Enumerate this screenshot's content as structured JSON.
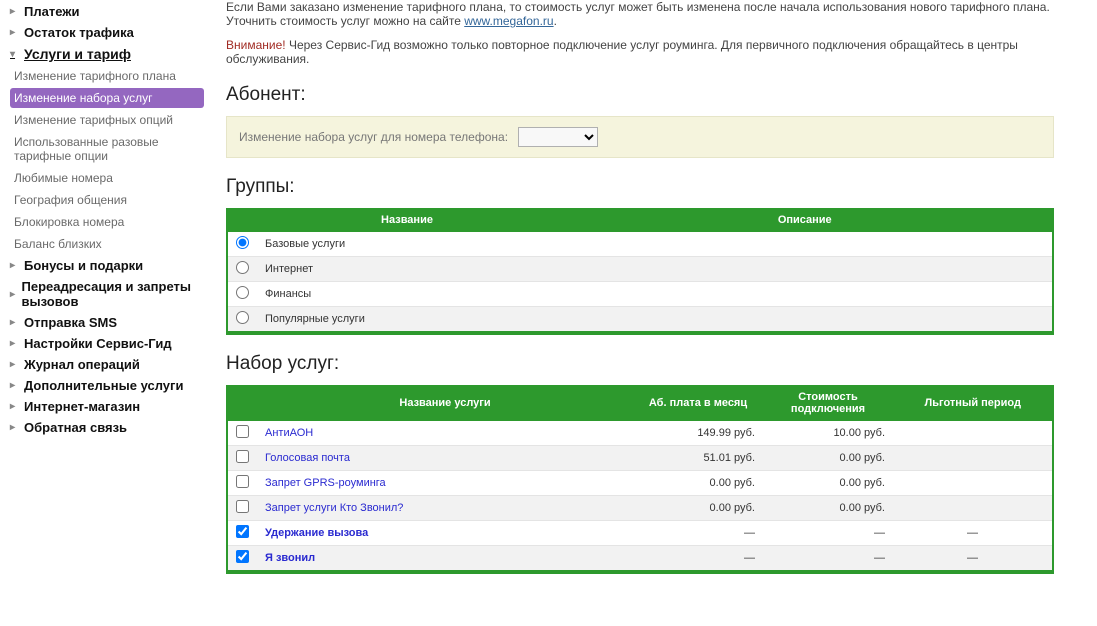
{
  "sidebar": {
    "items": [
      {
        "label": "Платежи",
        "bold": true,
        "expand": false,
        "arrow": "tri"
      },
      {
        "label": "Остаток трафика",
        "bold": true,
        "expand": false,
        "arrow": "tri"
      },
      {
        "label": "Услуги и тариф",
        "bold": true,
        "expand": true,
        "active": true,
        "arrow": "down",
        "children": [
          {
            "label": "Изменение тарифного плана"
          },
          {
            "label": "Изменение набора услуг",
            "selected": true
          },
          {
            "label": "Изменение тарифных опций"
          },
          {
            "label": "Использованные разовые тарифные опции"
          },
          {
            "label": "Любимые номера"
          },
          {
            "label": "География общения"
          },
          {
            "label": "Блокировка номера"
          },
          {
            "label": "Баланс близких"
          }
        ]
      },
      {
        "label": "Бонусы и подарки",
        "bold": true,
        "arrow": "tri"
      },
      {
        "label": "Переадресация и запреты вызовов",
        "bold": true,
        "arrow": "tri"
      },
      {
        "label": "Отправка SMS",
        "bold": true,
        "arrow": "tri"
      },
      {
        "label": "Настройки Сервис-Гид",
        "bold": true,
        "arrow": "tri"
      },
      {
        "label": "Журнал операций",
        "bold": true,
        "arrow": "tri"
      },
      {
        "label": "Дополнительные услуги",
        "bold": true,
        "arrow": "tri"
      },
      {
        "label": "Интернет-магазин",
        "bold": true,
        "arrow": "tri"
      },
      {
        "label": "Обратная связь",
        "bold": true,
        "arrow": "tri"
      }
    ]
  },
  "intro": {
    "line1": "Если Вами заказано изменение тарифного плана, то стоимость услуг может быть изменена после начала использования нового тарифного плана.",
    "line2_pre": "Уточнить стоимость услуг можно на сайте ",
    "line2_link": "www.megafon.ru",
    "line2_post": ".",
    "warn_label": "Внимание!",
    "warn_text": " Через Сервис-Гид возможно только повторное подключение услуг роуминга. Для первичного подключения обращайтесь в центры обслуживания."
  },
  "section_subscriber": "Абонент:",
  "phonebar": {
    "label": "Изменение набора услуг для номера телефона:",
    "value": ""
  },
  "section_groups": "Группы:",
  "groups": {
    "headers": [
      "Название",
      "Описание"
    ],
    "rows": [
      {
        "name": "Базовые услуги",
        "desc": "",
        "selected": true
      },
      {
        "name": "Интернет",
        "desc": ""
      },
      {
        "name": "Финансы",
        "desc": ""
      },
      {
        "name": "Популярные услуги",
        "desc": ""
      }
    ]
  },
  "section_services": "Набор услуг:",
  "services": {
    "headers": [
      "Название услуги",
      "Аб. плата в месяц",
      "Стоимость подключения",
      "Льготный период"
    ],
    "rows": [
      {
        "name": "АнтиАОН",
        "fee": "149.99 руб.",
        "conn": "10.00 руб.",
        "grace": "",
        "checked": false
      },
      {
        "name": "Голосовая почта",
        "fee": "51.01 руб.",
        "conn": "0.00 руб.",
        "grace": "",
        "checked": false
      },
      {
        "name": "Запрет GPRS-роуминга",
        "fee": "0.00 руб.",
        "conn": "0.00 руб.",
        "grace": "",
        "checked": false
      },
      {
        "name": "Запрет услуги Кто Звонил?",
        "fee": "0.00 руб.",
        "conn": "0.00 руб.",
        "grace": "",
        "checked": false
      },
      {
        "name": "Удержание вызова",
        "fee": "—",
        "conn": "—",
        "grace": "—",
        "checked": true,
        "bold": true
      },
      {
        "name": "Я звонил",
        "fee": "—",
        "conn": "—",
        "grace": "—",
        "checked": true,
        "bold": true
      }
    ]
  }
}
